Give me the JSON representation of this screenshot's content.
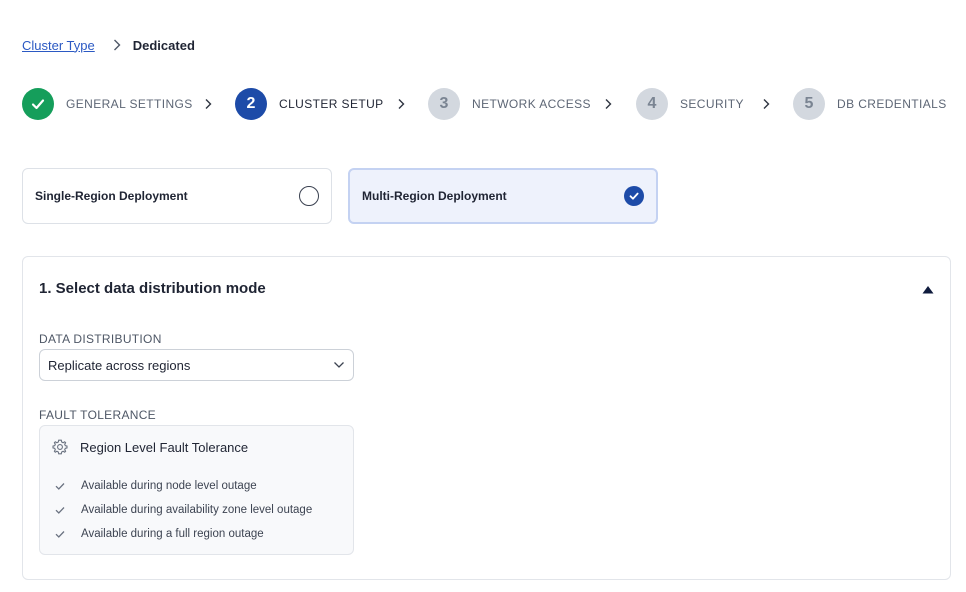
{
  "breadcrumb": {
    "parent": "Cluster Type",
    "current": "Dedicated"
  },
  "stepper": {
    "steps": [
      {
        "number": "",
        "label": "GENERAL SETTINGS",
        "state": "done"
      },
      {
        "number": "2",
        "label": "CLUSTER SETUP",
        "state": "active"
      },
      {
        "number": "3",
        "label": "NETWORK ACCESS",
        "state": "todo"
      },
      {
        "number": "4",
        "label": "SECURITY",
        "state": "todo"
      },
      {
        "number": "5",
        "label": "DB CREDENTIALS",
        "state": "todo"
      }
    ]
  },
  "deployment": {
    "single_label": "Single-Region Deployment",
    "multi_label": "Multi-Region Deployment",
    "selected": "multi"
  },
  "section": {
    "title": "1. Select data distribution mode",
    "data_distribution": {
      "label": "DATA DISTRIBUTION",
      "value": "Replicate across regions"
    },
    "fault_tolerance": {
      "label": "FAULT TOLERANCE",
      "title": "Region Level Fault Tolerance",
      "items": [
        "Available during node level outage",
        "Available during availability zone level outage",
        "Available during a full region outage"
      ]
    }
  },
  "colors": {
    "accent": "#1d4ba8",
    "success": "#159e5b",
    "link": "#2b59c3",
    "inactive_step": "#d3d8df"
  }
}
